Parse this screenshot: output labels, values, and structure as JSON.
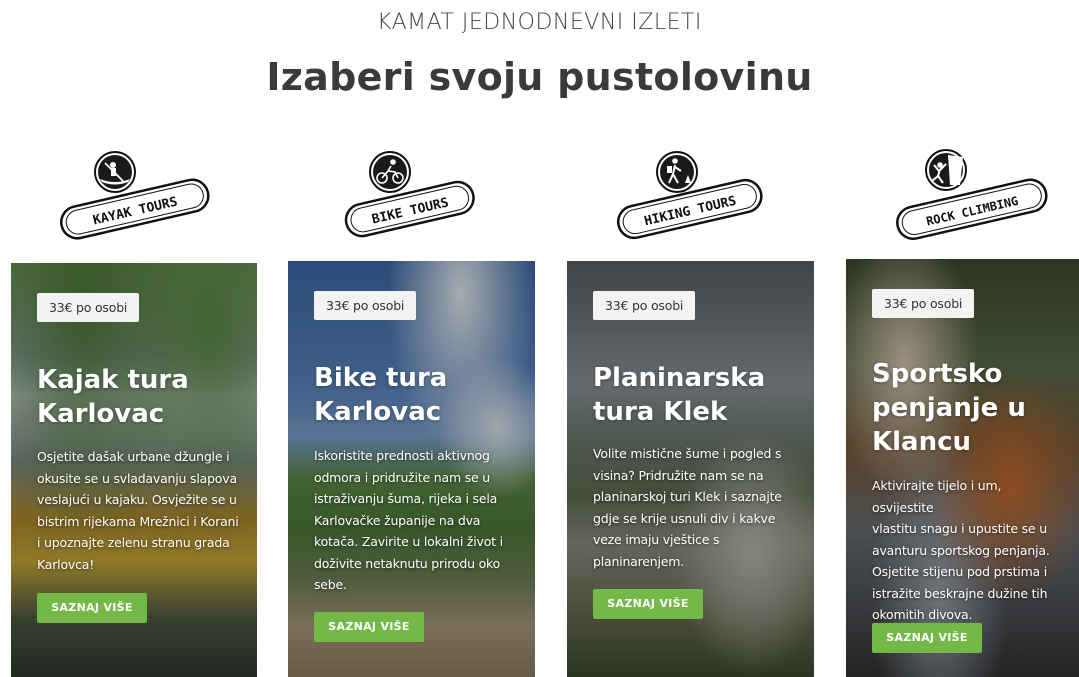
{
  "header": {
    "eyebrow": "KAMAT JEDNODNEVNI IZLETI",
    "title": "Izaberi svoju pustolovinu"
  },
  "badges": [
    {
      "label": "KAYAK TOURS",
      "icon": "kayak-icon"
    },
    {
      "label": "BIKE TOURS",
      "icon": "bike-icon"
    },
    {
      "label": "HIKING TOURS",
      "icon": "hiker-icon"
    },
    {
      "label": "ROCK CLIMBING",
      "icon": "climber-icon"
    }
  ],
  "cards": [
    {
      "price": "33€ po osobi",
      "title_line1": "Kajak tura",
      "title_line2": "Karlovac",
      "title_line3": "",
      "desc": [
        "Osjetite dašak urbane džungle i",
        "okusite se u svladavanju slapova",
        "veslajući u kajaku. Osvježite se u",
        "bistrim rijekama Mrežnici i Korani",
        "i upoznajte zelenu stranu grada",
        "Karlovca!"
      ],
      "button": "SAZNAJ VIŠE"
    },
    {
      "price": "33€ po osobi",
      "title_line1": "Bike tura",
      "title_line2": "Karlovac",
      "title_line3": "",
      "desc": [
        "Iskoristite prednosti aktivnog",
        "odmora i pridružite nam se u",
        "istraživanju šuma, rijeka i sela",
        "Karlovačke županije na dva",
        "kotača. Zavirite u lokalni život i",
        "doživite netaknutu prirodu oko",
        "sebe."
      ],
      "button": "SAZNAJ VIŠE"
    },
    {
      "price": "33€ po osobi",
      "title_line1": "Planinarska",
      "title_line2": "tura Klek",
      "title_line3": "",
      "desc": [
        "Volite mistične šume i pogled s",
        "visina? Pridružite nam se na",
        "planinarskoj turi Klek i saznajte",
        "gdje se krije usnuli div i kakve",
        "veze imaju vještice s",
        "planinarenjem."
      ],
      "button": "SAZNAJ VIŠE"
    },
    {
      "price": "33€ po osobi",
      "title_line1": "Sportsko",
      "title_line2": "penjanje u",
      "title_line3": "Klancu",
      "desc": [
        "Aktivirajte tijelo i um, osvijestite",
        "vlastitu snagu i upustite se u",
        "avanturu sportskog penjanja.",
        "Osjetite stijenu pod prstima i",
        "istražite beskrajne dužine tih",
        "okomitih divova."
      ],
      "button": "SAZNAJ VIŠE"
    }
  ],
  "colors": {
    "button": "#74b947",
    "heading": "#3a3a3a"
  }
}
